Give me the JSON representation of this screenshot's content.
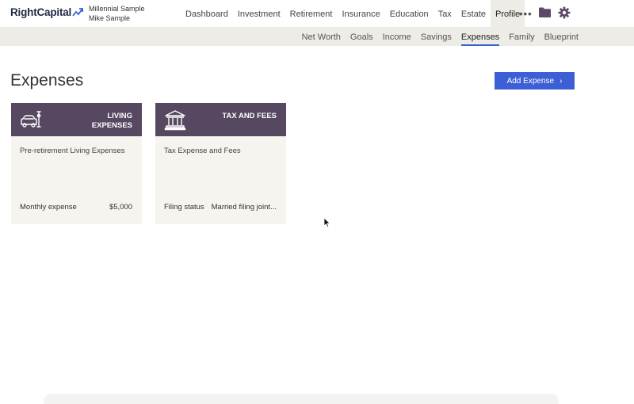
{
  "header": {
    "logo": "RightCapital",
    "client_primary": "Millennial Sample",
    "client_secondary": "Mike Sample",
    "nav": [
      "Dashboard",
      "Investment",
      "Retirement",
      "Insurance",
      "Education",
      "Tax",
      "Estate",
      "Profile"
    ],
    "nav_more": "•••",
    "active_nav": "Profile"
  },
  "subnav": {
    "items": [
      "Net Worth",
      "Goals",
      "Income",
      "Savings",
      "Expenses",
      "Family",
      "Blueprint"
    ],
    "active": "Expenses"
  },
  "page": {
    "title": "Expenses",
    "add_button": "Add Expense"
  },
  "cards": [
    {
      "icon": "car-icon",
      "title": "LIVING EXPENSES",
      "name": "Pre-retirement Living Expenses",
      "footer_label": "Monthly expense",
      "footer_value": "$5,000"
    },
    {
      "icon": "bank-icon",
      "title": "TAX AND FEES",
      "name": "Tax Expense and Fees",
      "footer_label": "Filing status",
      "footer_value": "Married filing joint..."
    }
  ],
  "colors": {
    "accent": "#3d5fd6",
    "card_header": "#574862",
    "card_body": "#f6f4ef",
    "subnav_bg": "#eeece6"
  }
}
